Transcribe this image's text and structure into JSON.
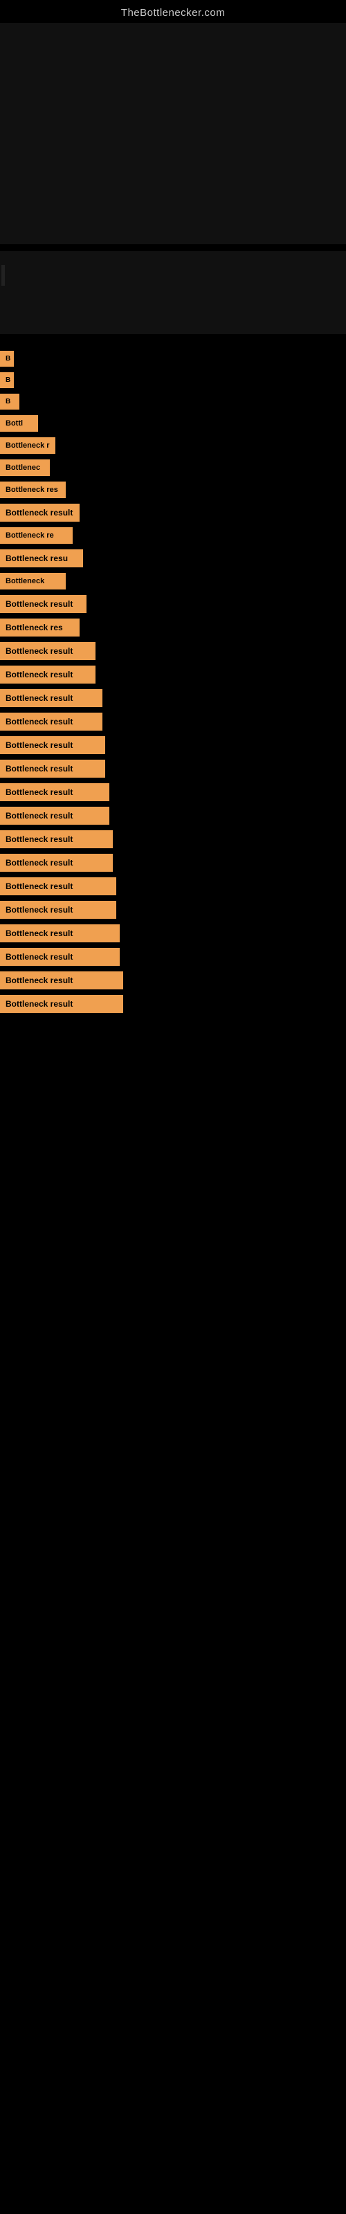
{
  "site": {
    "title": "TheBottlenecker.com"
  },
  "results": [
    {
      "label": "B",
      "width_class": "w-20",
      "index": 1
    },
    {
      "label": "B",
      "width_class": "w-20",
      "index": 2
    },
    {
      "label": "B",
      "width_class": "w-28",
      "index": 3
    },
    {
      "label": "Bottl",
      "width_class": "w-50",
      "index": 4
    },
    {
      "label": "Bottleneck r",
      "width_class": "w-75",
      "index": 5
    },
    {
      "label": "Bottlenec",
      "width_class": "w-70",
      "index": 6
    },
    {
      "label": "Bottleneck res",
      "width_class": "w-90",
      "index": 7
    },
    {
      "label": "Bottleneck result",
      "width_class": "w-110",
      "index": 8
    },
    {
      "label": "Bottleneck re",
      "width_class": "w-100",
      "index": 9
    },
    {
      "label": "Bottleneck resu",
      "width_class": "w-115",
      "index": 10
    },
    {
      "label": "Bottleneck",
      "width_class": "w-90",
      "index": 11
    },
    {
      "label": "Bottleneck result",
      "width_class": "w-120",
      "index": 12
    },
    {
      "label": "Bottleneck res",
      "width_class": "w-110",
      "index": 13
    },
    {
      "label": "Bottleneck result",
      "width_class": "w-130",
      "index": 14
    },
    {
      "label": "Bottleneck result",
      "width_class": "w-130",
      "index": 15
    },
    {
      "label": "Bottleneck result",
      "width_class": "w-140",
      "index": 16
    },
    {
      "label": "Bottleneck result",
      "width_class": "w-140",
      "index": 17
    },
    {
      "label": "Bottleneck result",
      "width_class": "w-145",
      "index": 18
    },
    {
      "label": "Bottleneck result",
      "width_class": "w-145",
      "index": 19
    },
    {
      "label": "Bottleneck result",
      "width_class": "w-150",
      "index": 20
    },
    {
      "label": "Bottleneck result",
      "width_class": "w-150",
      "index": 21
    },
    {
      "label": "Bottleneck result",
      "width_class": "w-155",
      "index": 22
    },
    {
      "label": "Bottleneck result",
      "width_class": "w-155",
      "index": 23
    },
    {
      "label": "Bottleneck result",
      "width_class": "w-160",
      "index": 24
    },
    {
      "label": "Bottleneck result",
      "width_class": "w-160",
      "index": 25
    },
    {
      "label": "Bottleneck result",
      "width_class": "w-165",
      "index": 26
    },
    {
      "label": "Bottleneck result",
      "width_class": "w-165",
      "index": 27
    },
    {
      "label": "Bottleneck result",
      "width_class": "w-170",
      "index": 28
    },
    {
      "label": "Bottleneck result",
      "width_class": "w-170",
      "index": 29
    }
  ]
}
